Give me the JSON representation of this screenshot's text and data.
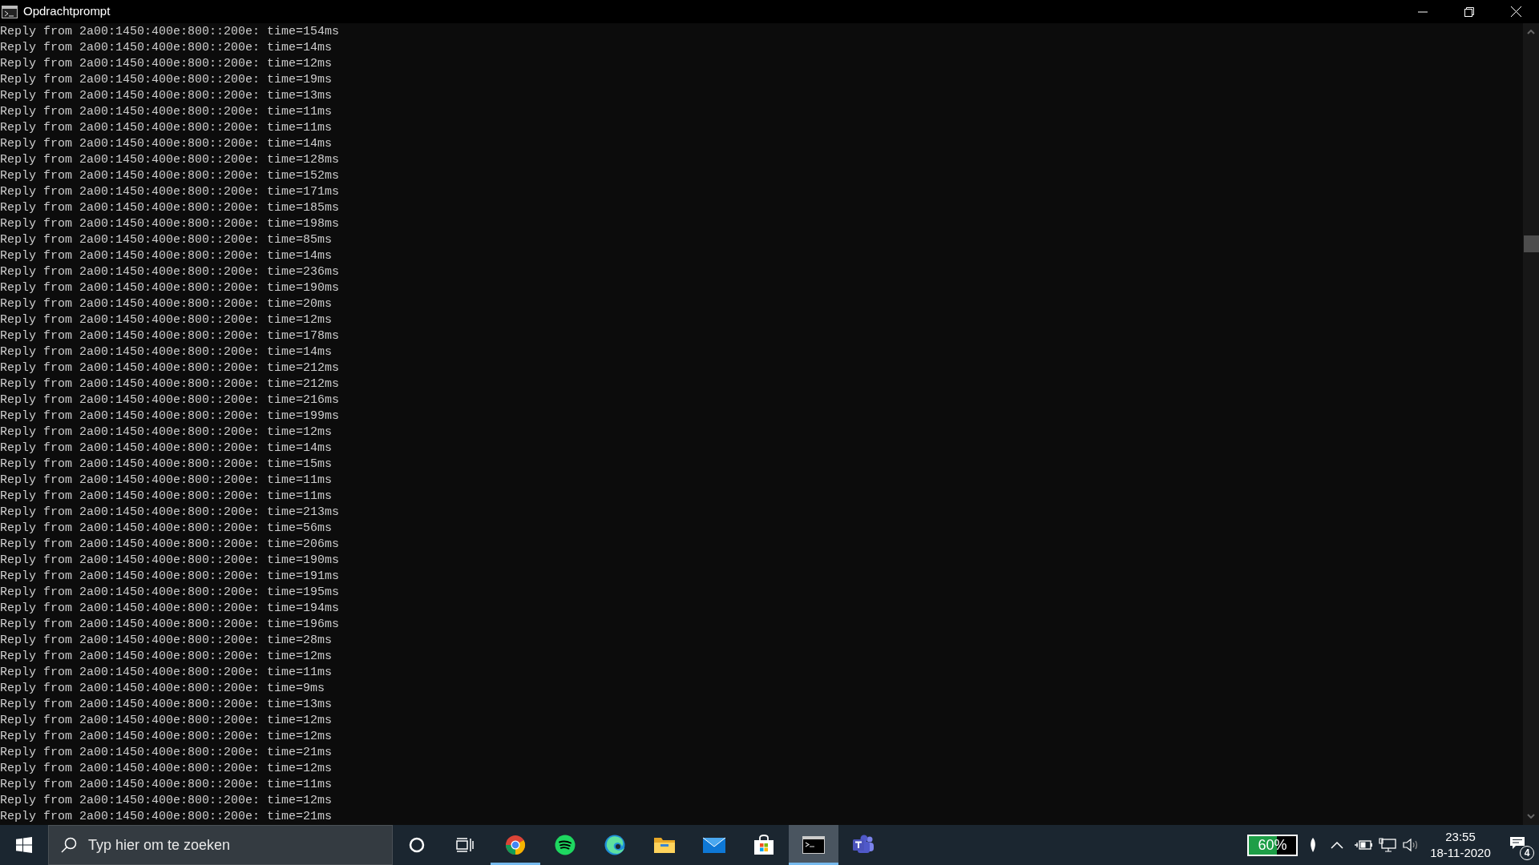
{
  "window": {
    "title": "Opdrachtprompt"
  },
  "console": {
    "lines": [
      "Reply from 2a00:1450:400e:800::200e: time=154ms",
      "Reply from 2a00:1450:400e:800::200e: time=14ms",
      "Reply from 2a00:1450:400e:800::200e: time=12ms",
      "Reply from 2a00:1450:400e:800::200e: time=19ms",
      "Reply from 2a00:1450:400e:800::200e: time=13ms",
      "Reply from 2a00:1450:400e:800::200e: time=11ms",
      "Reply from 2a00:1450:400e:800::200e: time=11ms",
      "Reply from 2a00:1450:400e:800::200e: time=14ms",
      "Reply from 2a00:1450:400e:800::200e: time=128ms",
      "Reply from 2a00:1450:400e:800::200e: time=152ms",
      "Reply from 2a00:1450:400e:800::200e: time=171ms",
      "Reply from 2a00:1450:400e:800::200e: time=185ms",
      "Reply from 2a00:1450:400e:800::200e: time=198ms",
      "Reply from 2a00:1450:400e:800::200e: time=85ms",
      "Reply from 2a00:1450:400e:800::200e: time=14ms",
      "Reply from 2a00:1450:400e:800::200e: time=236ms",
      "Reply from 2a00:1450:400e:800::200e: time=190ms",
      "Reply from 2a00:1450:400e:800::200e: time=20ms",
      "Reply from 2a00:1450:400e:800::200e: time=12ms",
      "Reply from 2a00:1450:400e:800::200e: time=178ms",
      "Reply from 2a00:1450:400e:800::200e: time=14ms",
      "Reply from 2a00:1450:400e:800::200e: time=212ms",
      "Reply from 2a00:1450:400e:800::200e: time=212ms",
      "Reply from 2a00:1450:400e:800::200e: time=216ms",
      "Reply from 2a00:1450:400e:800::200e: time=199ms",
      "Reply from 2a00:1450:400e:800::200e: time=12ms",
      "Reply from 2a00:1450:400e:800::200e: time=14ms",
      "Reply from 2a00:1450:400e:800::200e: time=15ms",
      "Reply from 2a00:1450:400e:800::200e: time=11ms",
      "Reply from 2a00:1450:400e:800::200e: time=11ms",
      "Reply from 2a00:1450:400e:800::200e: time=213ms",
      "Reply from 2a00:1450:400e:800::200e: time=56ms",
      "Reply from 2a00:1450:400e:800::200e: time=206ms",
      "Reply from 2a00:1450:400e:800::200e: time=190ms",
      "Reply from 2a00:1450:400e:800::200e: time=191ms",
      "Reply from 2a00:1450:400e:800::200e: time=195ms",
      "Reply from 2a00:1450:400e:800::200e: time=194ms",
      "Reply from 2a00:1450:400e:800::200e: time=196ms",
      "Reply from 2a00:1450:400e:800::200e: time=28ms",
      "Reply from 2a00:1450:400e:800::200e: time=12ms",
      "Reply from 2a00:1450:400e:800::200e: time=11ms",
      "Reply from 2a00:1450:400e:800::200e: time=9ms",
      "Reply from 2a00:1450:400e:800::200e: time=13ms",
      "Reply from 2a00:1450:400e:800::200e: time=12ms",
      "Reply from 2a00:1450:400e:800::200e: time=12ms",
      "Reply from 2a00:1450:400e:800::200e: time=21ms",
      "Reply from 2a00:1450:400e:800::200e: time=12ms",
      "Reply from 2a00:1450:400e:800::200e: time=11ms",
      "Reply from 2a00:1450:400e:800::200e: time=12ms",
      "Reply from 2a00:1450:400e:800::200e: time=21ms"
    ]
  },
  "taskbar": {
    "search": {
      "placeholder": "Typ hier om te zoeken"
    },
    "apps": [
      {
        "kind": "chrome",
        "running": true,
        "active": false
      },
      {
        "kind": "spotify",
        "running": false,
        "active": false
      },
      {
        "kind": "edge",
        "running": false,
        "active": false
      },
      {
        "kind": "explorer",
        "running": false,
        "active": false
      },
      {
        "kind": "mail",
        "running": false,
        "active": false
      },
      {
        "kind": "store",
        "running": false,
        "active": false
      },
      {
        "kind": "terminal",
        "running": true,
        "active": true
      },
      {
        "kind": "teams",
        "running": false,
        "active": false
      }
    ],
    "tray": {
      "battery": {
        "label": "60%",
        "level": 0.6
      },
      "time": "23:55",
      "date": "18-11-2020",
      "notifications": "4"
    }
  }
}
